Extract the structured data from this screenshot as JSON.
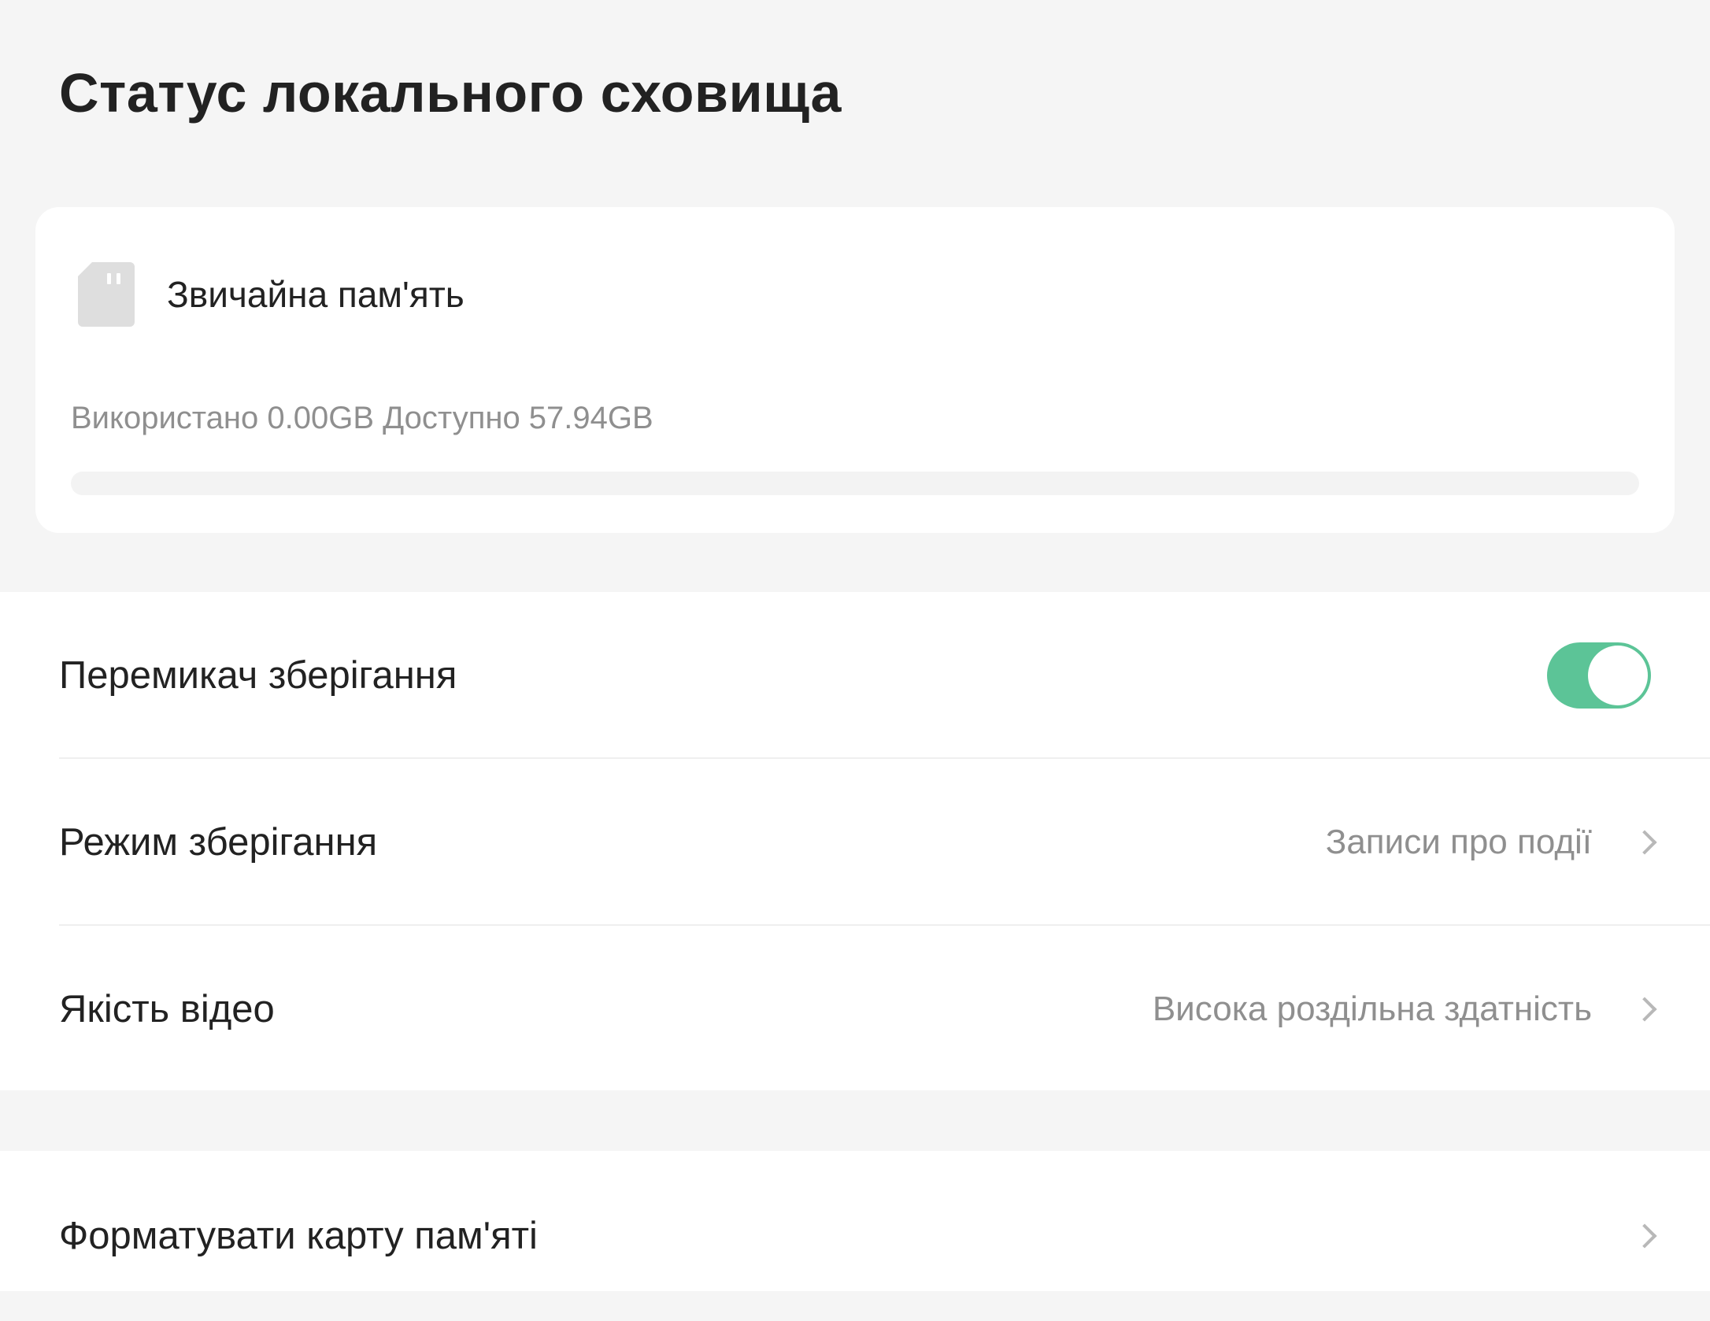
{
  "header": {
    "title": "Статус локального сховища"
  },
  "storage_card": {
    "icon": "sd-card-icon",
    "title": "Звичайна пам'ять",
    "usage_text": "Використано 0.00GB Доступно 57.94GB",
    "used_fraction": 0.0
  },
  "settings": {
    "storage_switch": {
      "label": "Перемикач зберігання",
      "enabled": true
    },
    "storage_mode": {
      "label": "Режим зберігання",
      "value": "Записи про події"
    },
    "video_quality": {
      "label": "Якість відео",
      "value": "Висока роздільна здатність"
    },
    "format_card": {
      "label": "Форматувати карту пам'яті"
    }
  },
  "colors": {
    "accent": "#5cc497",
    "background": "#f5f5f5",
    "card": "#ffffff",
    "secondary_text": "#8f8f8f"
  }
}
